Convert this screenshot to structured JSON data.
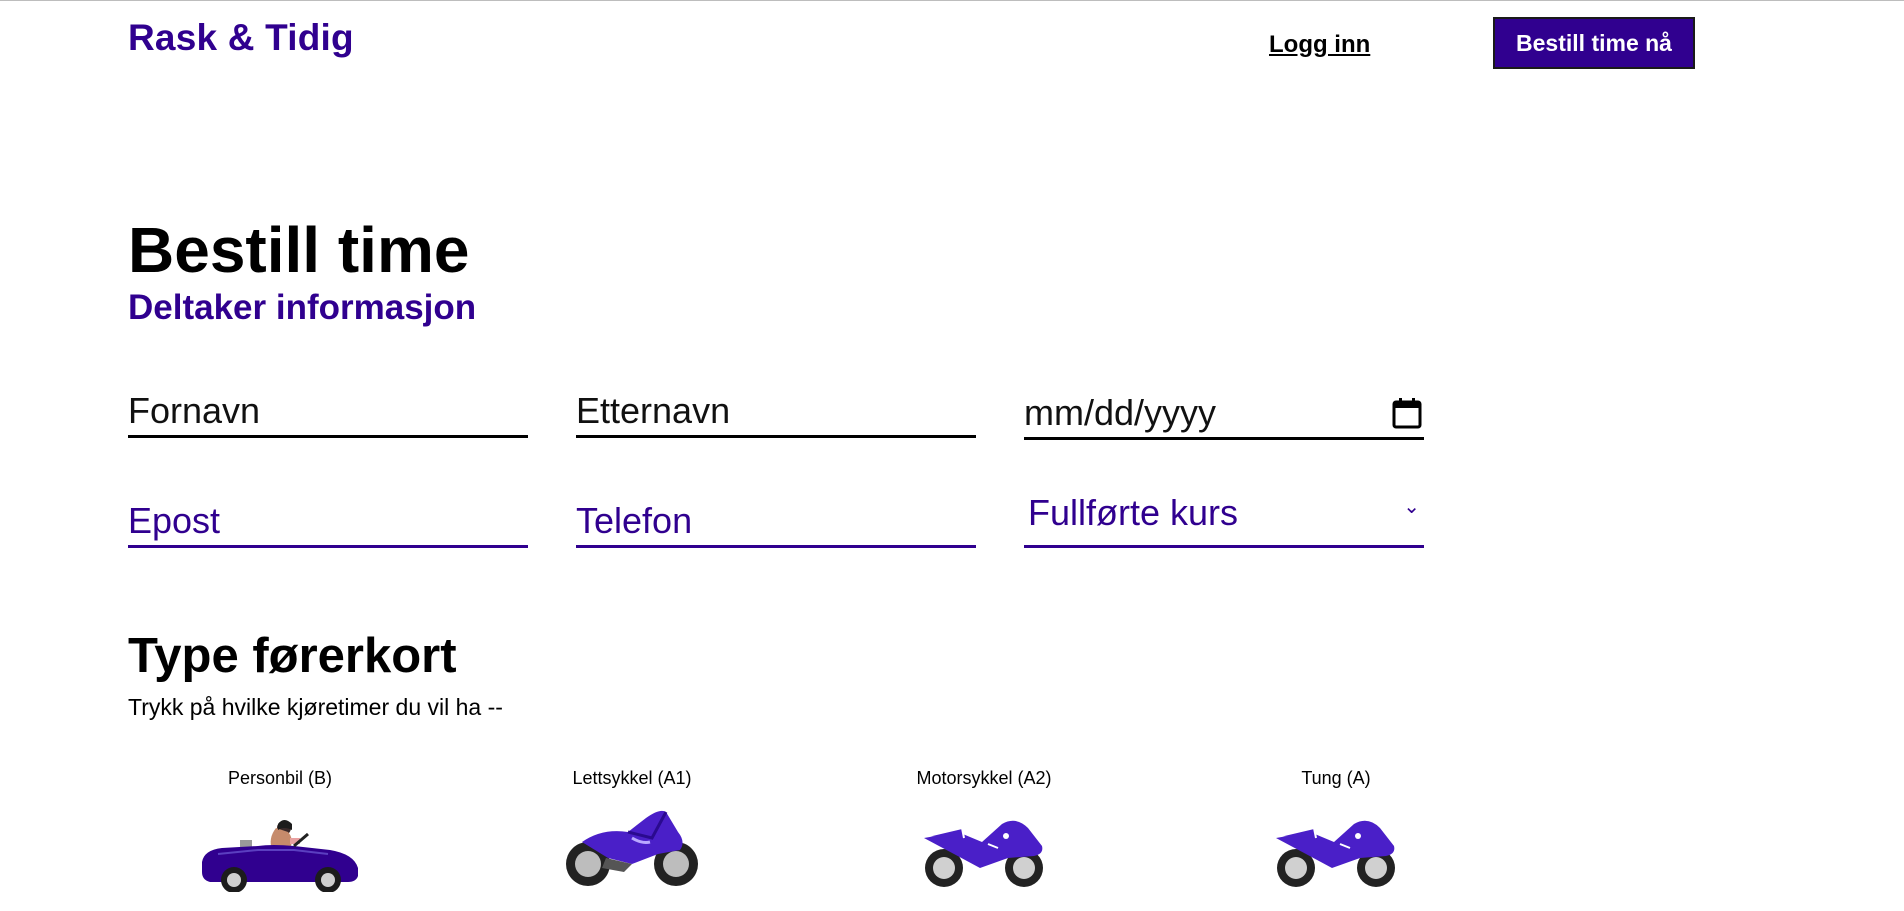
{
  "header": {
    "logo": "Rask & Tidig",
    "login_label": "Logg inn",
    "cta_label": "Bestill time nå"
  },
  "page": {
    "title": "Bestill time",
    "subtitle": "Deltaker informasjon"
  },
  "form": {
    "first_name_placeholder": "Fornavn",
    "last_name_placeholder": "Etternavn",
    "date_placeholder": "mm/dd/yyyy",
    "email_placeholder": "Epost",
    "phone_placeholder": "Telefon",
    "courses_select_value": "Fullførte kurs"
  },
  "license": {
    "heading": "Type førerkort",
    "help": "Trykk på hvilke kjøretimer du vil ha --",
    "options": [
      {
        "label": "Personbil (B)",
        "icon": "car-icon"
      },
      {
        "label": "Lettsykkel (A1)",
        "icon": "sport-motorcycle-icon"
      },
      {
        "label": "Motorsykkel (A2)",
        "icon": "motorcycle-icon"
      },
      {
        "label": "Tung (A)",
        "icon": "heavy-motorcycle-icon"
      }
    ]
  },
  "colors": {
    "brand": "#30008f",
    "text": "#000000",
    "background": "#ffffff"
  }
}
